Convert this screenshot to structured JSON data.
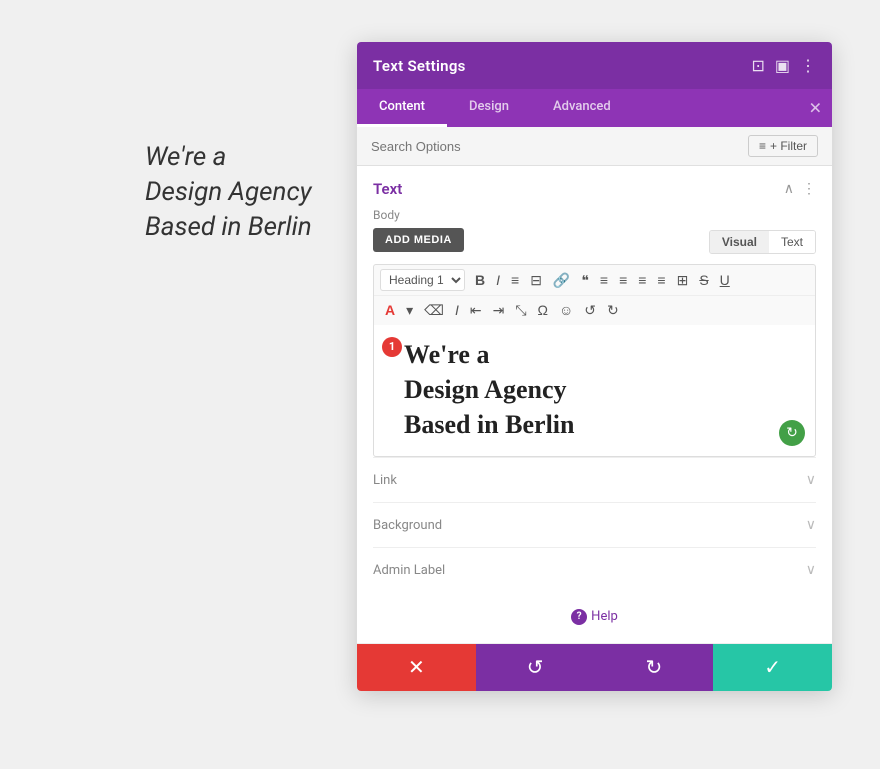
{
  "background": {
    "text_line1": "We're a",
    "text_line2": "Design Agency",
    "text_line3": "Based in Berlin"
  },
  "panel": {
    "title": "Text Settings",
    "header_icons": [
      "resize-icon",
      "fullscreen-icon",
      "more-icon"
    ],
    "tabs": [
      {
        "label": "Content",
        "active": true
      },
      {
        "label": "Design",
        "active": false
      },
      {
        "label": "Advanced",
        "active": false
      }
    ],
    "search_placeholder": "Search Options",
    "filter_label": "+ Filter",
    "section": {
      "title": "Text",
      "body_label": "Body",
      "add_media_label": "ADD MEDIA",
      "visual_label": "Visual",
      "text_label": "Text",
      "heading_option": "Heading 1",
      "editor_content_line1": "We're a",
      "editor_content_line2": "Design Agency",
      "editor_content_line3": "Based in Berlin",
      "badge_number": "1"
    },
    "accordions": [
      {
        "label": "Link"
      },
      {
        "label": "Background"
      },
      {
        "label": "Admin Label"
      }
    ],
    "help_label": "Help",
    "actions": {
      "cancel_icon": "✕",
      "undo_icon": "↺",
      "redo_icon": "↻",
      "save_icon": "✓"
    }
  }
}
